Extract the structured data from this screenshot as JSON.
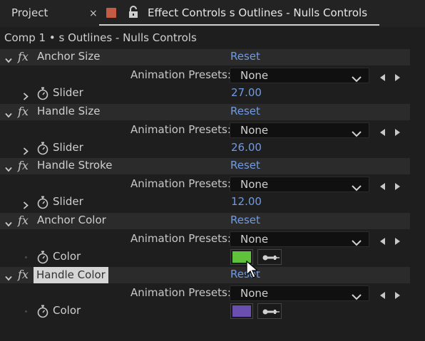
{
  "tabs": {
    "project_label": "Project",
    "close_glyph": "×",
    "active_label": "Effect Controls s Outlines - Nulls Controls",
    "label_color": "#c45b45"
  },
  "comp_path": "Comp 1 • s Outlines - Nulls Controls",
  "fx_glyph": "fx",
  "effects": [
    {
      "name": "Anchor Size",
      "reset": "Reset",
      "presets_label": "Animation Presets:",
      "preset_value": "None",
      "property": {
        "label": "Slider",
        "value": "27.00",
        "kind": "slider"
      }
    },
    {
      "name": "Handle Size",
      "reset": "Reset",
      "presets_label": "Animation Presets:",
      "preset_value": "None",
      "property": {
        "label": "Slider",
        "value": "26.00",
        "kind": "slider"
      }
    },
    {
      "name": "Handle Stroke",
      "reset": "Reset",
      "presets_label": "Animation Presets:",
      "preset_value": "None",
      "property": {
        "label": "Slider",
        "value": "12.00",
        "kind": "slider"
      }
    },
    {
      "name": "Anchor Color",
      "reset": "Reset",
      "presets_label": "Animation Presets:",
      "preset_value": "None",
      "property": {
        "label": "Color",
        "color": "#5fc23a",
        "kind": "color"
      }
    },
    {
      "name": "Handle Color",
      "reset": "Reset",
      "presets_label": "Animation Presets:",
      "preset_value": "None",
      "property": {
        "label": "Color",
        "color": "#6a4fb0",
        "kind": "color"
      },
      "selected": true
    }
  ],
  "colors": {
    "link": "#6f9be6",
    "panel_bg": "#1e1e1e",
    "effect_row_bg": "#2b2b2b"
  },
  "icons": [
    "chevron-down-icon",
    "fx-icon",
    "stopwatch-icon",
    "chevron-right-icon",
    "lock-icon",
    "panel-menu-icon",
    "eyedropper-icon",
    "arrow-left-icon",
    "arrow-right-icon",
    "mouse-cursor-icon"
  ]
}
